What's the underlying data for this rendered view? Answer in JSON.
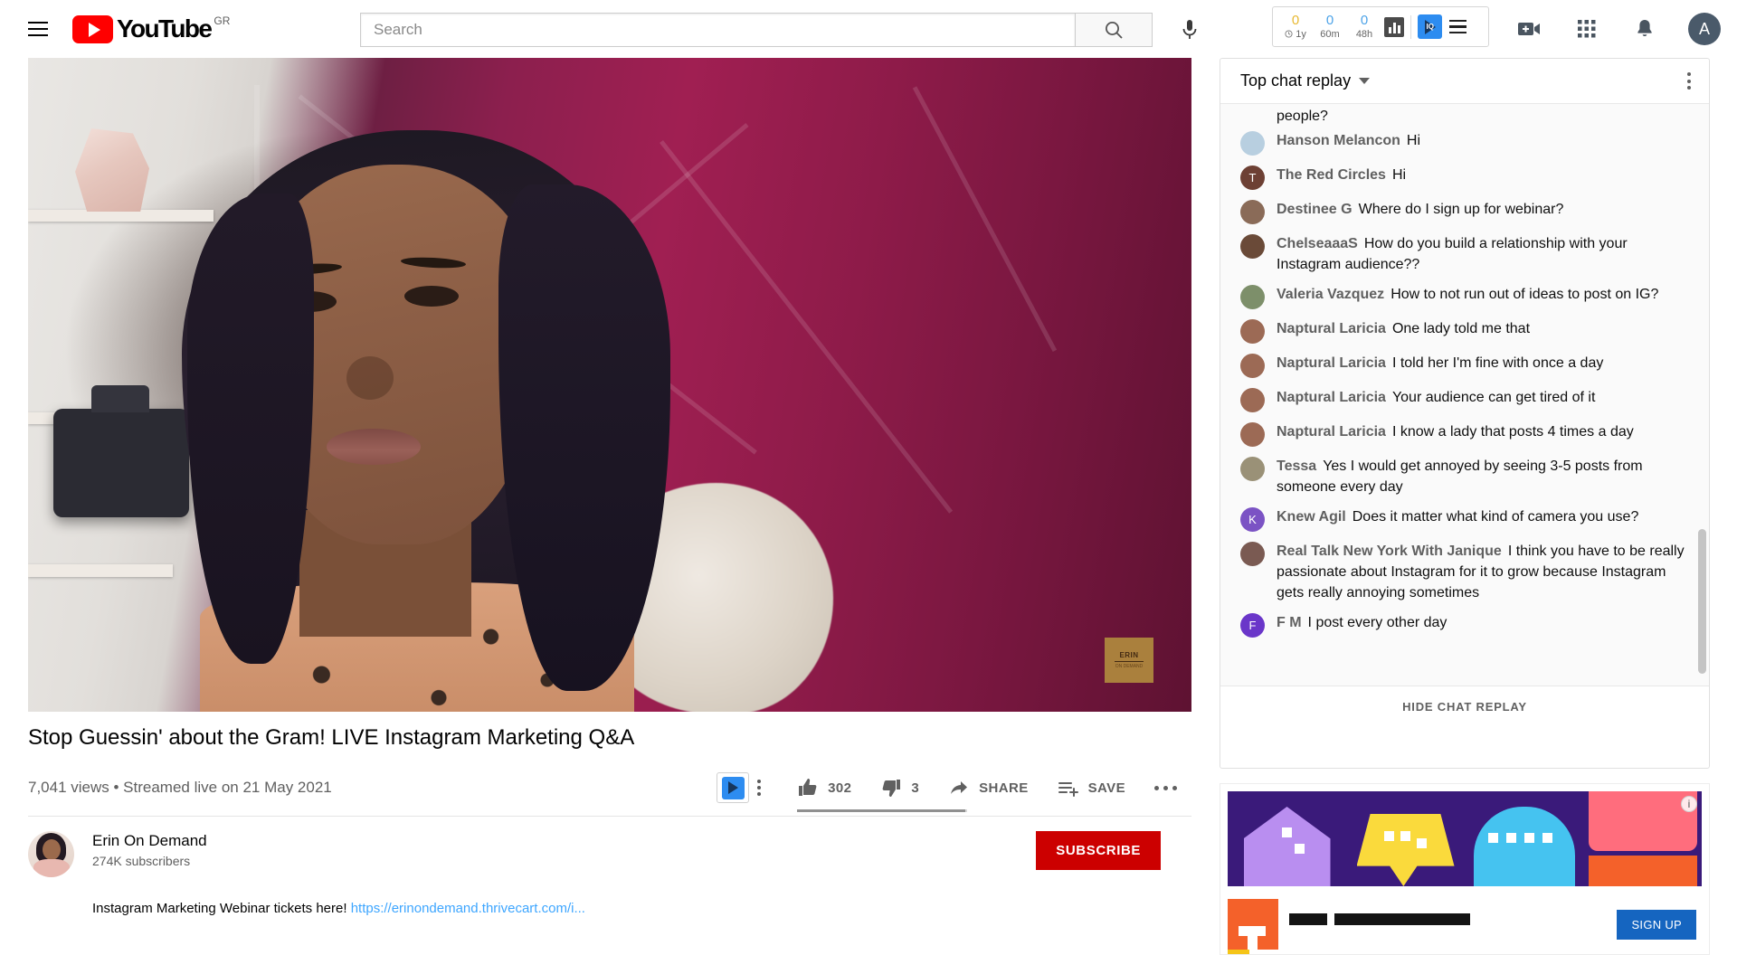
{
  "masthead": {
    "menu_icon": "hamburger-icon",
    "logo_text": "YouTube",
    "country_code": "GR",
    "search": {
      "placeholder": "Search",
      "value": "",
      "search_icon": "search-icon"
    },
    "mic_icon": "microphone-icon",
    "extension": {
      "stats": [
        {
          "num": "0",
          "label": "1y",
          "clock_icon": "clock-icon"
        },
        {
          "num": "0",
          "label": "60m"
        },
        {
          "num": "0",
          "label": "48h"
        }
      ],
      "chart_icon": "bar-chart-icon",
      "brand_icon": "vidiq-icon",
      "menu_icon": "hamburger-icon"
    },
    "right_icons": [
      {
        "name": "create-video-icon"
      },
      {
        "name": "apps-grid-icon"
      },
      {
        "name": "notifications-bell-icon"
      }
    ],
    "avatar_letter": "A"
  },
  "video": {
    "watermark_line1": "ERIN",
    "watermark_line2": "ON DEMAND",
    "title": "Stop Guessin' about the Gram! LIVE Instagram Marketing Q&A",
    "meta": "7,041 views • Streamed live on 21 May 2021",
    "actions": {
      "vidiq_icon": "vidiq-icon",
      "kebab_icon": "kebab-menu-icon",
      "like_icon": "thumbs-up-icon",
      "like_count": "302",
      "dislike_icon": "thumbs-down-icon",
      "dislike_count": "3",
      "share_icon": "share-arrow-icon",
      "share_label": "SHARE",
      "save_icon": "save-playlist-icon",
      "save_label": "SAVE",
      "more_icon": "more-horizontal-icon"
    }
  },
  "channel": {
    "name": "Erin On Demand",
    "subscribers": "274K subscribers",
    "subscribe_label": "SUBSCRIBE",
    "avatar": "channel-avatar"
  },
  "description": {
    "text": "Instagram Marketing Webinar tickets here! ",
    "link": "https://erinondemand.thrivecart.com/i..."
  },
  "chat": {
    "header_title": "Top chat replay",
    "caret_icon": "chevron-down-icon",
    "menu_icon": "kebab-menu-icon",
    "partial_top": "people?",
    "hide_label": "HIDE CHAT REPLAY",
    "messages": [
      {
        "author": "Hanson Melancon",
        "text": "Hi",
        "avatar_color": "#b8cfe0",
        "initial": ""
      },
      {
        "author": "The Red Circles",
        "text": "Hi",
        "avatar_color": "#6d4034",
        "initial": "T"
      },
      {
        "author": "Destinee G",
        "text": "Where do I sign up for webinar?",
        "avatar_color": "#8a6b58",
        "initial": ""
      },
      {
        "author": "ChelseaaaS",
        "text": "How do you build a relationship with your Instagram audience??",
        "avatar_color": "#6a4a38",
        "initial": ""
      },
      {
        "author": "Valeria Vazquez",
        "text": "How to not run out of ideas to post on IG?",
        "avatar_color": "#7d8f6a",
        "initial": ""
      },
      {
        "author": "Naptural Laricia",
        "text": "One lady told me that",
        "avatar_color": "#9c6a55",
        "initial": ""
      },
      {
        "author": "Naptural Laricia",
        "text": "I told her I'm fine with once a day",
        "avatar_color": "#9c6a55",
        "initial": ""
      },
      {
        "author": "Naptural Laricia",
        "text": "Your audience can get tired of it",
        "avatar_color": "#9c6a55",
        "initial": ""
      },
      {
        "author": "Naptural Laricia",
        "text": "I know a lady that posts 4 times a day",
        "avatar_color": "#9c6a55",
        "initial": ""
      },
      {
        "author": "Tessa",
        "text": "Yes I would get annoyed by seeing 3-5 posts from someone every day",
        "avatar_color": "#9a9177",
        "initial": ""
      },
      {
        "author": "Knew Agil",
        "text": "Does it matter what kind of camera you use?",
        "avatar_color": "#7b53c4",
        "initial": "K"
      },
      {
        "author": "Real Talk New York With Janique",
        "text": "I think you have to be really passionate about Instagram for it to grow because Instagram gets really annoying sometimes",
        "avatar_color": "#7a5a52",
        "initial": ""
      },
      {
        "author": "F M",
        "text": "I post every other day",
        "avatar_color": "#6a36c9",
        "initial": "F"
      }
    ]
  },
  "ad": {
    "info_icon": "info-icon",
    "banner_name": "ad-banner-image",
    "cta_label": "SIGN UP",
    "logo_name": "advertiser-logo"
  },
  "colors": {
    "youtube_red": "#ff0000",
    "subscribe_red": "#cc0000",
    "link_blue": "#3ea6ff",
    "vidiq_blue": "#2d8cf0",
    "stat_yellow": "#e8b931",
    "stat_blue": "#4da3e8"
  }
}
